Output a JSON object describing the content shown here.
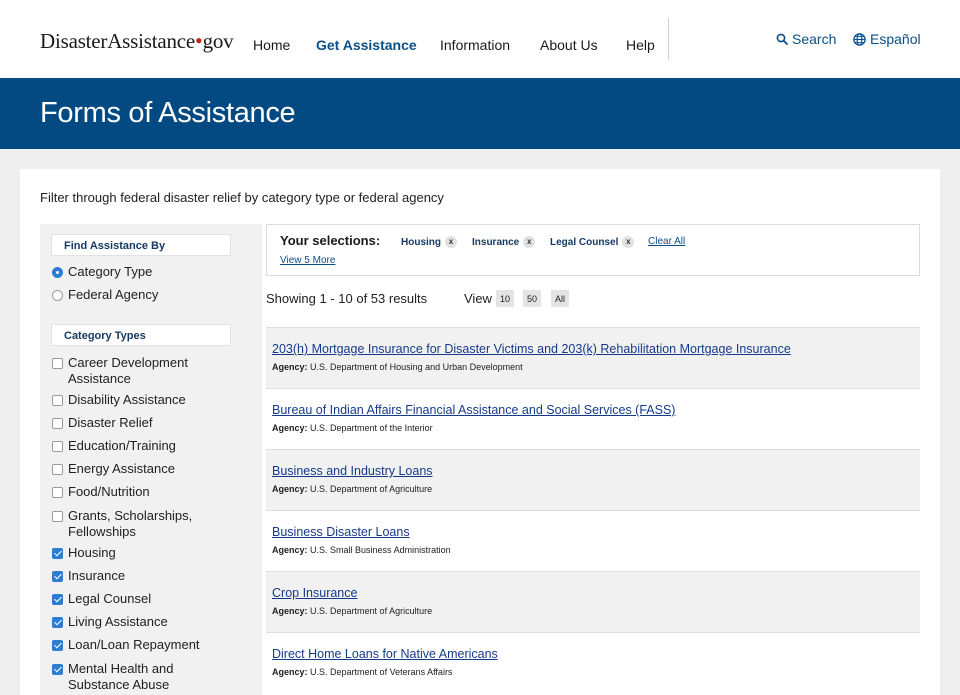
{
  "header": {
    "logo": {
      "part1": "Disaster",
      "part2": "Assistance",
      "dot": "•",
      "gov": "gov"
    },
    "nav": [
      "Home",
      "Get Assistance",
      "Information",
      "About Us",
      "Help"
    ],
    "active_nav": "Get Assistance",
    "search_label": "Search",
    "language_label": "Español"
  },
  "banner": {
    "title": "Forms of Assistance"
  },
  "intro": "Filter through federal disaster relief by category type or federal agency",
  "sidebar": {
    "find_heading": "Find Assistance By",
    "find_options": [
      {
        "label": "Category Type",
        "selected": true
      },
      {
        "label": "Federal Agency",
        "selected": false
      }
    ],
    "category_heading": "Category Types",
    "categories": [
      {
        "label": "Career Development Assistance",
        "checked": false
      },
      {
        "label": "Disability Assistance",
        "checked": false
      },
      {
        "label": "Disaster Relief",
        "checked": false
      },
      {
        "label": "Education/Training",
        "checked": false
      },
      {
        "label": "Energy Assistance",
        "checked": false
      },
      {
        "label": "Food/Nutrition",
        "checked": false
      },
      {
        "label": "Grants, Scholarships, Fellowships",
        "checked": false
      },
      {
        "label": "Housing",
        "checked": true
      },
      {
        "label": "Insurance",
        "checked": true
      },
      {
        "label": "Legal Counsel",
        "checked": true
      },
      {
        "label": "Living Assistance",
        "checked": true
      },
      {
        "label": "Loan/Loan Repayment",
        "checked": true
      },
      {
        "label": "Mental Health and Substance Abuse",
        "checked": true
      }
    ]
  },
  "selections": {
    "title": "Your selections:",
    "chips": [
      "Housing",
      "Insurance",
      "Legal Counsel"
    ],
    "remove_glyph": "x",
    "clear_all": "Clear All",
    "view_more": "View 5 More"
  },
  "results_bar": {
    "showing": "Showing 1 - 10 of 53 results",
    "view_label": "View",
    "page_sizes": [
      "10",
      "50",
      "All"
    ]
  },
  "results": [
    {
      "title": "203(h) Mortgage Insurance for Disaster Victims and 203(k) Rehabilitation Mortgage Insurance",
      "agency": "U.S. Department of Housing and Urban Development"
    },
    {
      "title": "Bureau of Indian Affairs Financial Assistance and Social Services (FASS)",
      "agency": "U.S. Department of the Interior"
    },
    {
      "title": "Business and Industry Loans",
      "agency": "U.S. Department of Agriculture"
    },
    {
      "title": "Business Disaster Loans",
      "agency": "U.S. Small Business Administration"
    },
    {
      "title": "Crop Insurance",
      "agency": "U.S. Department of Agriculture"
    },
    {
      "title": "Direct Home Loans for Native Americans",
      "agency": "U.S. Department of Veterans Affairs"
    }
  ],
  "agency_label": "Agency:",
  "colors": {
    "banner": "#034a82",
    "link": "#0a4f8a",
    "accent_red": "#c4261d",
    "checkbox_on": "#2d7dd2"
  }
}
